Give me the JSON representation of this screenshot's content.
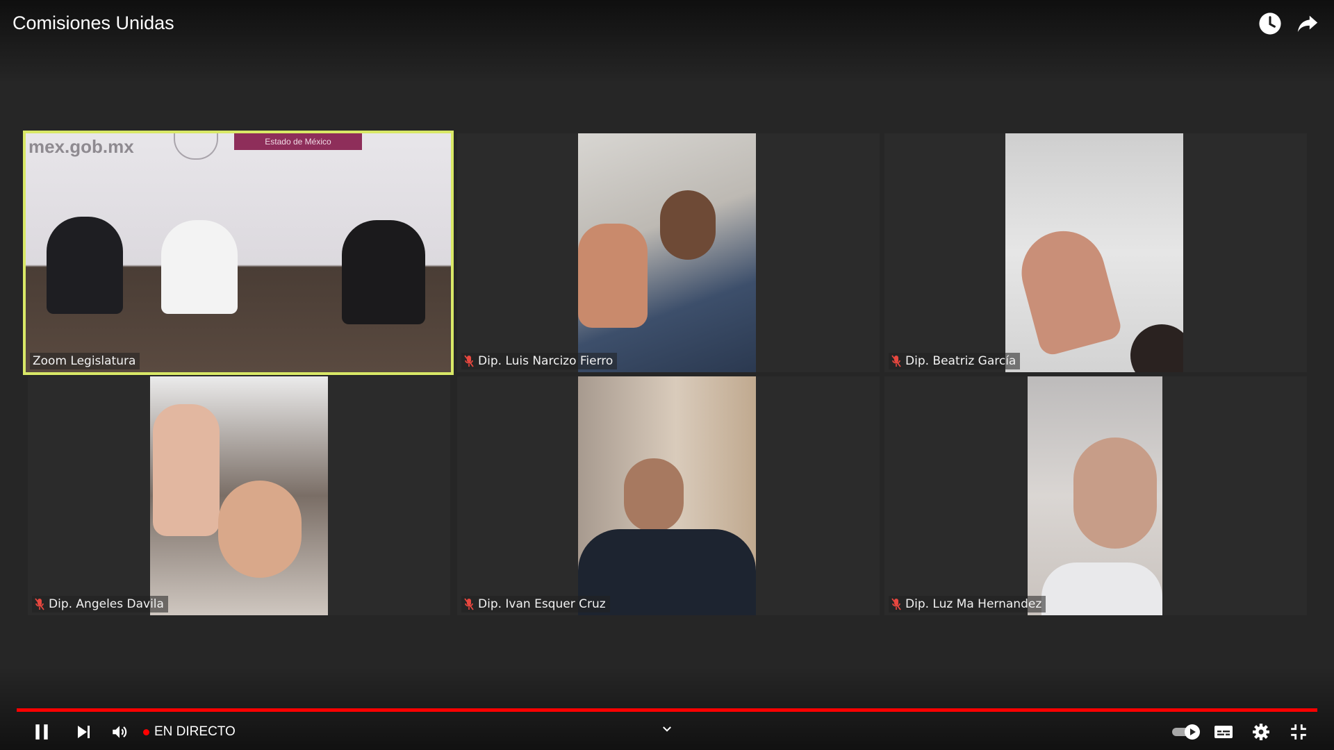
{
  "header": {
    "title": "Comisiones Unidas",
    "watch_later_icon": "clock-icon",
    "share_icon": "share-icon"
  },
  "tiles": [
    {
      "name": "Zoom Legislatura",
      "active": true,
      "muted": false,
      "banner_text": "mex.gob.mx",
      "banner_sub": "Estado de México"
    },
    {
      "name": "Dip. Luis Narcizo Fierro",
      "active": false,
      "muted": true
    },
    {
      "name": "Dip. Beatriz García",
      "active": false,
      "muted": true
    },
    {
      "name": "Dip. Angeles Davila",
      "active": false,
      "muted": true
    },
    {
      "name": "Dip. Ivan Esquer Cruz",
      "active": false,
      "muted": true
    },
    {
      "name": "Dip. Luz Ma Hernandez",
      "active": false,
      "muted": true
    }
  ],
  "player": {
    "progress": 1.0,
    "live_label": "EN DIRECTO",
    "icons": [
      "pause-icon",
      "next-icon",
      "volume-icon",
      "chevron-down-icon",
      "autoplay-toggle-icon",
      "subtitles-icon",
      "settings-icon",
      "exit-fullscreen-icon"
    ]
  },
  "colors": {
    "background": "#262626",
    "active_border": "#d9e867",
    "live_red": "#ff0000",
    "muted_mic": "#e8473f"
  }
}
